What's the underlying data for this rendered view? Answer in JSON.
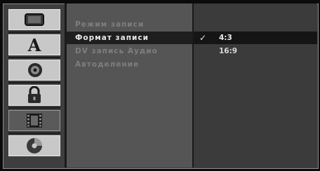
{
  "sidebar": {
    "icons": [
      {
        "name": "tv-icon"
      },
      {
        "name": "language-icon",
        "glyph": "A"
      },
      {
        "name": "audio-icon"
      },
      {
        "name": "lock-icon"
      },
      {
        "name": "film-icon"
      },
      {
        "name": "disc-icon"
      }
    ],
    "active_index": 4
  },
  "menu": {
    "items": [
      {
        "label": "Режим записи"
      },
      {
        "label": "Формат записи"
      },
      {
        "label": "DV запись Аудио"
      },
      {
        "label": "Автоделение"
      }
    ],
    "selected_index": 1
  },
  "options": {
    "items": [
      {
        "label": "4:3",
        "checked": true
      },
      {
        "label": "16:9",
        "checked": false
      }
    ],
    "selected_index": 0,
    "check_glyph": "✓"
  }
}
